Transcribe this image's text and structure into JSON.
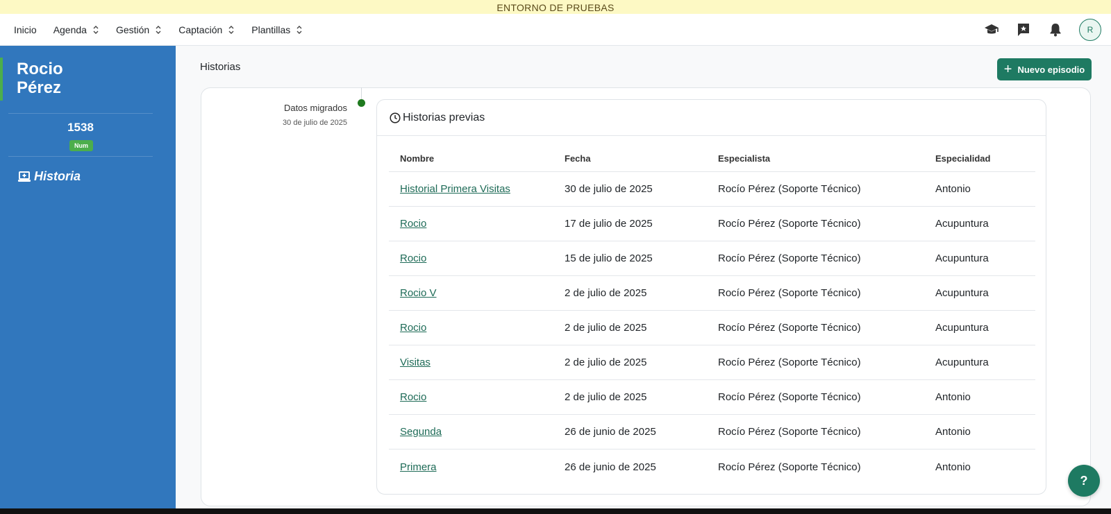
{
  "env_banner": "ENTORNO DE PRUEBAS",
  "nav": {
    "items": [
      {
        "label": "Inicio",
        "has_chevron": false
      },
      {
        "label": "Agenda",
        "has_chevron": true
      },
      {
        "label": "Gestión",
        "has_chevron": true
      },
      {
        "label": "Captación",
        "has_chevron": true
      },
      {
        "label": "Plantillas",
        "has_chevron": true
      }
    ],
    "icons": [
      "graduation-cap-icon",
      "flag-star-icon",
      "bell-icon"
    ],
    "avatar_initial": "R"
  },
  "sidebar": {
    "patient_first": "Rocio",
    "patient_last": "Pérez",
    "patient_number": "1538",
    "number_badge": "Num",
    "history_link": "Historia"
  },
  "main": {
    "title": "Historias",
    "new_button": "Nuevo episodio",
    "timeline": {
      "label": "Datos migrados",
      "date": "30 de julio de 2025"
    },
    "card_title": "Historias previas",
    "table": {
      "headers": [
        "Nombre",
        "Fecha",
        "Especialista",
        "Especialidad"
      ],
      "rows": [
        {
          "nombre": "Historial Primera Visitas",
          "fecha": "30 de julio de 2025",
          "especialista": "Rocío Pérez (Soporte Técnico)",
          "especialidad": "Antonio"
        },
        {
          "nombre": "Rocio",
          "fecha": "17 de julio de 2025",
          "especialista": "Rocío Pérez (Soporte Técnico)",
          "especialidad": "Acupuntura"
        },
        {
          "nombre": "Rocio",
          "fecha": "15 de julio de 2025",
          "especialista": "Rocío Pérez (Soporte Técnico)",
          "especialidad": "Acupuntura"
        },
        {
          "nombre": "Rocio V",
          "fecha": "2 de julio de 2025",
          "especialista": "Rocío Pérez (Soporte Técnico)",
          "especialidad": "Acupuntura"
        },
        {
          "nombre": "Rocio",
          "fecha": "2 de julio de 2025",
          "especialista": "Rocío Pérez (Soporte Técnico)",
          "especialidad": "Acupuntura"
        },
        {
          "nombre": "Visitas",
          "fecha": "2 de julio de 2025",
          "especialista": "Rocío Pérez (Soporte Técnico)",
          "especialidad": "Acupuntura"
        },
        {
          "nombre": "Rocio",
          "fecha": "2 de julio de 2025",
          "especialista": "Rocío Pérez (Soporte Técnico)",
          "especialidad": "Antonio"
        },
        {
          "nombre": "Segunda",
          "fecha": "26 de junio de 2025",
          "especialista": "Rocío Pérez (Soporte Técnico)",
          "especialidad": "Antonio"
        },
        {
          "nombre": "Primera",
          "fecha": "26 de junio de 2025",
          "especialista": "Rocío Pérez (Soporte Técnico)",
          "especialidad": "Antonio"
        }
      ]
    }
  },
  "help_button": "?",
  "colors": {
    "sidebar_bg": "#3177bd",
    "primary_green": "#1e7a62",
    "accent_green": "#4cae4c",
    "banner_bg": "#fdf9c4"
  }
}
